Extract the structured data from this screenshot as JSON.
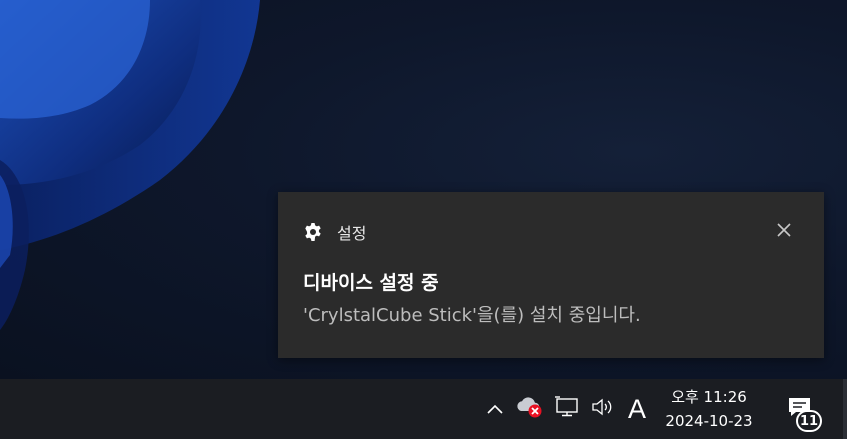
{
  "toast": {
    "app_name": "설정",
    "app_icon": "gear-icon",
    "title": "디바이스 설정 중",
    "body": "'CrylstalCube Stick'을(를) 설치 중입니다."
  },
  "tray": {
    "ime_indicator": "A",
    "time": "오후 11:26",
    "date": "2024-10-23",
    "notification_count": "11"
  },
  "colors": {
    "toast_bg": "#2b2b2b",
    "taskbar_bg": "#1b1d22",
    "cloud_error": "#e81123"
  }
}
